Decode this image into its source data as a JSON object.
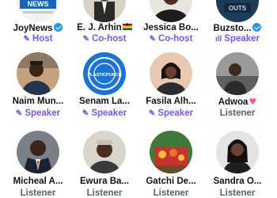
{
  "colors": {
    "host_accent": "#7856ff",
    "listener_text": "#536471",
    "name_text": "#0f1419",
    "verified_blue": "#1d9bf0"
  },
  "participants": [
    {
      "name": "JoyNews",
      "role": "Host",
      "role_icon": "sparkle-mic-icon",
      "badge": "verified-icon",
      "avatar_text": "NEWS"
    },
    {
      "name": "E. J. Arhin",
      "role": "Co-host",
      "role_icon": "sparkle-mic-icon",
      "badge": "ghana-flag-icon"
    },
    {
      "name": "Jessica Bo...",
      "role": "Co-host",
      "role_icon": "sparkle-mic-icon"
    },
    {
      "name": "Buzsto...",
      "role": "Speaker",
      "role_icon": "sound-bars-icon",
      "badge": "verified-icon",
      "avatar_text": "OUTS"
    },
    {
      "name": "Naim Mun...",
      "role": "Speaker",
      "role_icon": "sparkle-mic-icon"
    },
    {
      "name": "Senam La...",
      "role": "Speaker",
      "role_icon": "sparkle-mic-icon",
      "avatar_text": "PLASTICPUNCH"
    },
    {
      "name": "Fasila Alh...",
      "role": "Speaker",
      "role_icon": "sparkle-mic-icon"
    },
    {
      "name": "Adwoa",
      "role": "Listener",
      "badge": "pink-heart-icon"
    },
    {
      "name": "Micheal A...",
      "role": "Listener"
    },
    {
      "name": "Ewura Ba...",
      "role": "Listener"
    },
    {
      "name": "Gatchi De...",
      "role": "Listener"
    },
    {
      "name": "Sandra O...",
      "role": "Listener"
    }
  ]
}
